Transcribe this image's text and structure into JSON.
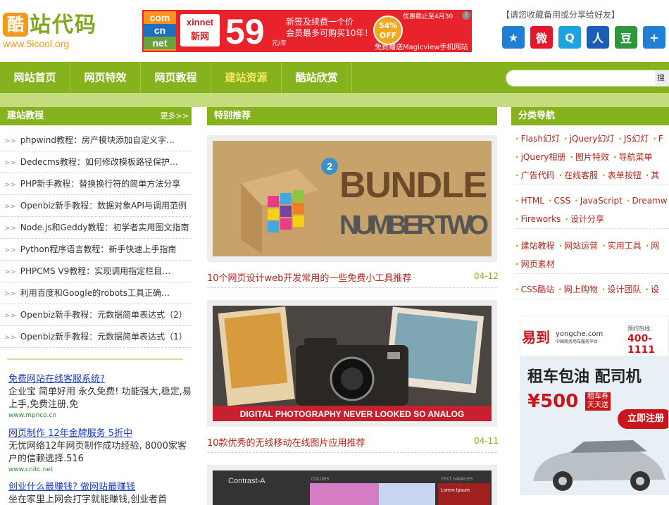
{
  "logo": {
    "badge": "酷",
    "text": "站代码",
    "url": "www.5icool.org"
  },
  "banner": {
    "com": [
      "com",
      "cn",
      "net"
    ],
    "brand_en": "xinnet",
    "brand_cn": "新网",
    "price": "59",
    "unit": "元/年",
    "line1": "新签及续费一个价",
    "line2": "会员最多可购买10年！",
    "badge_pct": "54%",
    "badge_off": "OFF",
    "deadline": "优惠截止至4月30",
    "gift": "免费赠送Magicview手机网站",
    "close": "i"
  },
  "share": {
    "hint": "【请您收藏备用或分享给好友】",
    "icons": [
      {
        "name": "favorite-icon",
        "glyph": "★",
        "color": "#1e7fd4"
      },
      {
        "name": "weibo-icon",
        "glyph": "微",
        "color": "#e6162d"
      },
      {
        "name": "qq-weibo-icon",
        "glyph": "Q",
        "color": "#1fa3e0"
      },
      {
        "name": "renren-icon",
        "glyph": "人",
        "color": "#1b5fb5"
      },
      {
        "name": "douban-icon",
        "glyph": "豆",
        "color": "#2e963d"
      },
      {
        "name": "more-share-icon",
        "glyph": "+",
        "color": "#1e7fd4"
      }
    ]
  },
  "nav": {
    "items": [
      "网站首页",
      "网页特效",
      "网页教程",
      "建站资源",
      "酷站欣赏"
    ],
    "active_index": 3,
    "search_button": "搜"
  },
  "left": {
    "heading": "建站教程",
    "more": "更多>>",
    "items": [
      "phpwind教程：房产模块添加自定义字…",
      "Dedecms教程：如何修改模板路径保护…",
      "PHP新手教程：替换换行符的简单方法分享",
      "Openbiz新手教程：数据对象API与调用范例",
      "Node.js和Geddy教程：初学者实用图文指南",
      "Python程序语言教程：新手快速上手指南",
      "PHPCMS V9教程：实现调用指定栏目…",
      "利用百度和Google的robots工具正确…",
      "Openbiz新手教程：元数据简单表达式（2）",
      "Openbiz新手教程：元数据简单表达式（1）"
    ],
    "ads": [
      {
        "title": "免费网站在线客服系统?",
        "desc": "企业宝 简单好用 永久免费! 功能强大,稳定,易上手,免费注册,免",
        "url": "www.mpnco.cn"
      },
      {
        "title": "网页制作 12年金牌服务 5折中",
        "desc": "无忧网络12年网页制作成功经验, 8000家客户的信赖选择.516",
        "url": "www.cnitc.net"
      },
      {
        "title": "创业什么最赚钱? 做网站最赚钱",
        "desc": "坐在家里上网会打字就能赚钱,创业者首",
        "url": ""
      }
    ]
  },
  "center": {
    "heading": "特别推荐",
    "features": [
      {
        "title": "10个网页设计web开发常用的一些免费小工具推荐",
        "date": "04-12",
        "img_text1": "BUNDLE",
        "img_text2": "NUMBER TWO",
        "img_num": "2"
      },
      {
        "title": "10款优秀的无线移动在线图片应用推荐",
        "date": "04-11",
        "img_text1": "DIGITAL PHOTOGRAPHY NEVER LOOKED SO ANALOG"
      },
      {
        "title": "",
        "date": "",
        "img_text1": "Contrast-A",
        "img_text2": "COLORS",
        "img_text3": "TEXT SAMPLES",
        "img_text4": "Lorem Ipsum"
      }
    ]
  },
  "right": {
    "heading": "分类导航",
    "groups": [
      [
        [
          "Flash幻灯",
          "jQuery幻灯",
          "JS幻灯",
          "F"
        ],
        [
          "jQuery相册",
          "图片特效",
          "导航菜单"
        ],
        [
          "广告代码",
          "在线客服",
          "表单按钮",
          "其"
        ]
      ],
      [
        [
          "HTML",
          "CSS",
          "JavaScript",
          "Dreamw"
        ],
        [
          "Fireworks",
          "设计分享"
        ]
      ],
      [
        [
          "建站教程",
          "网站运营",
          "实用工具",
          "网"
        ],
        [
          "网页素材"
        ]
      ],
      [
        [
          "CSS酷站",
          "网上购物",
          "设计团队",
          "设"
        ]
      ]
    ],
    "ad": {
      "logo": "易到",
      "site": "yongche.com",
      "site_sub": "中国商务用车服务平台",
      "phone_label": "预约热线:",
      "phone": "400-1111",
      "headline": "租车包油 配司机",
      "price": "¥500",
      "tag1": "租车券",
      "tag2": "天天送",
      "button": "立即注册"
    }
  }
}
